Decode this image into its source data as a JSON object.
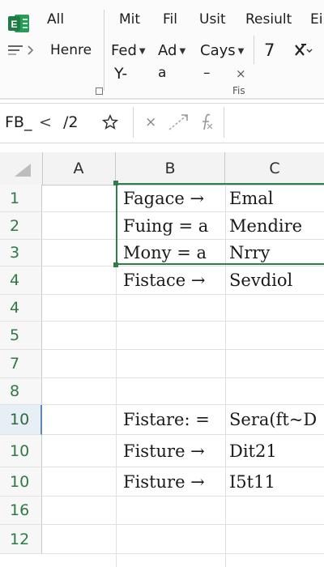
{
  "ribbon": {
    "tabs": [
      "All",
      "Mit",
      "Fil",
      "Usit",
      "Resiult",
      "Ei"
    ],
    "home_label": "Henre",
    "font_controls": [
      {
        "label": "Fed",
        "dropdown": true
      },
      {
        "label": "Ad",
        "dropdown": true
      },
      {
        "label": "Cays",
        "dropdown": true
      }
    ],
    "row2": {
      "a": "Y-",
      "b": "a",
      "c": "–",
      "d": "×"
    },
    "number_value": "7",
    "group_label": "Fis",
    "accent_color": "#1f7a44"
  },
  "formula_bar": {
    "name_box": "FB_",
    "back_symbol": "<",
    "value": "/2",
    "cancel_symbol": "×"
  },
  "grid": {
    "columns": [
      "A",
      "B",
      "C"
    ],
    "rows": [
      {
        "label": "1",
        "b": "Fagace →",
        "c": "Emal",
        "active": false
      },
      {
        "label": "2",
        "b": "Fuing = a",
        "c": "Mendire",
        "active": false
      },
      {
        "label": "3",
        "b": "Mony = a",
        "c": "Nrry",
        "active": false
      },
      {
        "label": "4",
        "b": "Fistace →",
        "c": "Sevdiol",
        "active": false
      },
      {
        "label": "4",
        "b": "",
        "c": "",
        "active": false
      },
      {
        "label": "5",
        "b": "",
        "c": "",
        "active": false
      },
      {
        "label": "7",
        "b": "",
        "c": "",
        "active": false
      },
      {
        "label": "8",
        "b": "",
        "c": "",
        "active": false
      },
      {
        "label": "10",
        "b": "Fistare: =",
        "c": "Sera(ft~D",
        "active": true
      },
      {
        "label": "10",
        "b": "Fisture →",
        "c": "Dit21",
        "active": false
      },
      {
        "label": "10",
        "b": "Fisture →",
        "c": "I5t11",
        "active": false
      },
      {
        "label": "16",
        "b": "",
        "c": "",
        "active": false
      },
      {
        "label": "12",
        "b": "",
        "c": "",
        "active": false
      }
    ],
    "selection_color": "#2f7d48"
  }
}
